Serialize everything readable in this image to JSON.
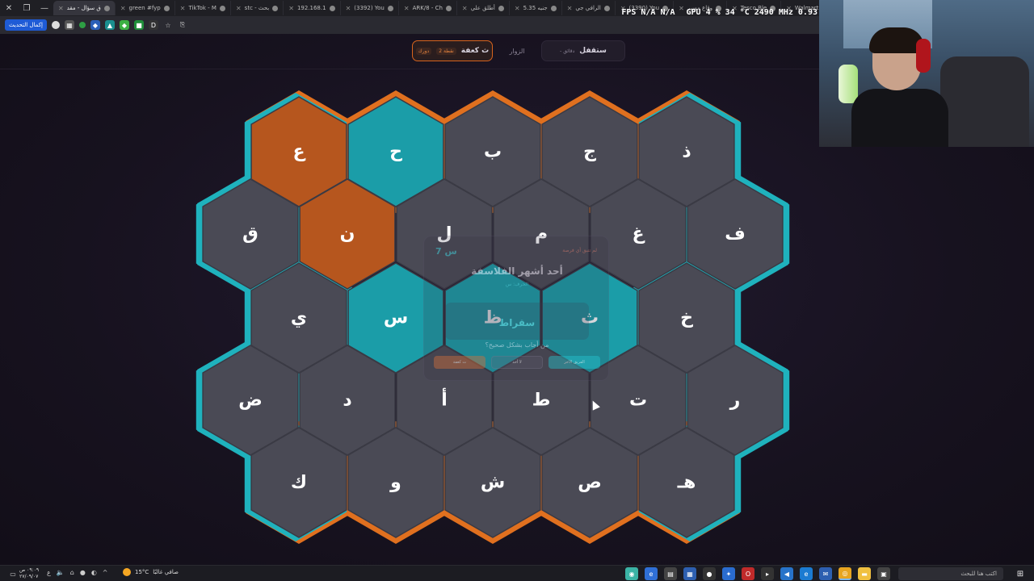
{
  "browser": {
    "tabs": [
      {
        "label": "ق سؤال - مقد",
        "active": true
      },
      {
        "label": "green #fyp",
        "active": false
      },
      {
        "label": "TikTok - M",
        "active": false
      },
      {
        "label": "stc - بحث",
        "active": false
      },
      {
        "label": "192.168.1",
        "active": false
      },
      {
        "label": "(3392) You",
        "active": false
      },
      {
        "label": "ARK/8 - Ch",
        "active": false
      },
      {
        "label": "أطلق علي",
        "active": false
      },
      {
        "label": "5.35 جنيه",
        "active": false
      },
      {
        "label": "الرافي جي",
        "active": false
      },
      {
        "label": "(3390) You",
        "active": false
      },
      {
        "label": "وقاع مسير",
        "active": false
      },
      {
        "label": "Tesco Ble",
        "active": false
      },
      {
        "label": "Walmart",
        "active": false
      }
    ],
    "new_tab": "+",
    "update_button": "إكمال التحديث",
    "colors": {
      "chrome": "#1f1f24",
      "update": "#1e5bd6"
    }
  },
  "overlay": {
    "fps_label": "FPS",
    "fps_value": "N/A",
    "fps_value2": "N/A",
    "gpu_label": "GPU",
    "gpu_load": "4 %",
    "gpu_temp": "34 °C",
    "gpu_clock": "2490 MHz",
    "gpu_extra": "0.93"
  },
  "game": {
    "nav": {
      "team_label": "ث كعفة",
      "team_badge": "دورك",
      "team_badge2": "2 نقطة",
      "visitors_label": "الزوار",
      "lock_label": "ستقفل",
      "lock_badge": "- دقائق"
    },
    "colors": {
      "orange": "#b6561e",
      "teal": "#1b9da8",
      "gray": "#4a4a55",
      "orange_border": "#e0701f",
      "teal_border": "#1fb2bd",
      "letter": "#ffffff"
    },
    "board": {
      "cols": 5,
      "rows": [
        [
          {
            "letter": "ع",
            "owner": "orange"
          },
          {
            "letter": "ح",
            "owner": "teal"
          },
          {
            "letter": "ب",
            "owner": "none"
          },
          {
            "letter": "ج",
            "owner": "none"
          },
          {
            "letter": "ذ",
            "owner": "none"
          }
        ],
        [
          {
            "letter": "ق",
            "owner": "none"
          },
          {
            "letter": "ن",
            "owner": "orange"
          },
          {
            "letter": "ل",
            "owner": "none"
          },
          {
            "letter": "م",
            "owner": "none"
          },
          {
            "letter": "غ",
            "owner": "none"
          },
          {
            "letter": "ف",
            "owner": "none"
          }
        ],
        [
          {
            "letter": "ي",
            "owner": "none"
          },
          {
            "letter": "س",
            "owner": "teal"
          },
          {
            "letter": "ظ",
            "owner": "teal"
          },
          {
            "letter": "ث",
            "owner": "teal"
          },
          {
            "letter": "خ",
            "owner": "none"
          }
        ],
        [
          {
            "letter": "ض",
            "owner": "none"
          },
          {
            "letter": "د",
            "owner": "none"
          },
          {
            "letter": "أ",
            "owner": "none"
          },
          {
            "letter": "ط",
            "owner": "none"
          },
          {
            "letter": "ت",
            "owner": "none"
          },
          {
            "letter": "ر",
            "owner": "none"
          }
        ],
        [
          {
            "letter": "ك",
            "owner": "none"
          },
          {
            "letter": "و",
            "owner": "none"
          },
          {
            "letter": "ش",
            "owner": "none"
          },
          {
            "letter": "ص",
            "owner": "none"
          },
          {
            "letter": "هـ",
            "owner": "none"
          }
        ]
      ]
    },
    "question_modal": {
      "timer": "7",
      "timer_letter": "س",
      "tag": "لم تتبق أي فرصة",
      "question": "أحد أشهر الفلاسفة",
      "hint": "الحرف: س",
      "answer": "سقراط",
      "ask": "من أجاب بشكل صحيح؟",
      "button_a": "ث كعفة",
      "button_b": "لا أحد",
      "button_c": "الفريق الآخر"
    }
  },
  "webcam": {
    "label": "streamer webcam"
  },
  "taskbar": {
    "time": "٠٩:٠٩ ص",
    "date": "٢٧/٠٩/٠٧",
    "lang": "ع",
    "temperature": "15°C",
    "weather_text": "صافي غالبًا",
    "search_placeholder": "اكتب هنا للبحث",
    "apps": [
      "camera-app",
      "edge-app",
      "calc-app",
      "store-app",
      "github-app",
      "settings-app",
      "opera-app",
      "terminal-app",
      "vscode-app",
      "edge2-app",
      "mail-app",
      "chrome-app",
      "folder-app",
      "taskview-app"
    ]
  }
}
